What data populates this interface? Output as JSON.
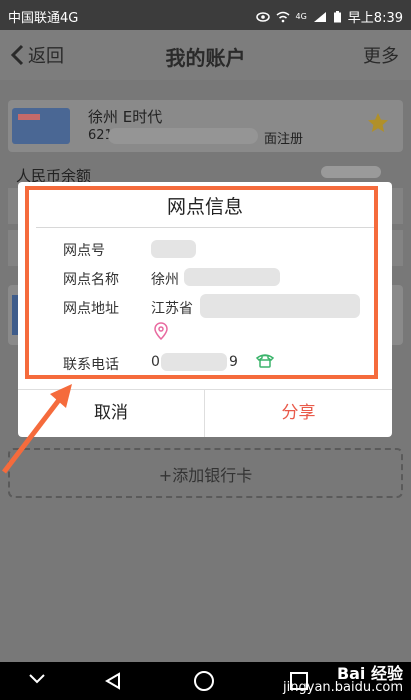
{
  "status": {
    "carrier": "中国联通4G",
    "time": "早上8:39",
    "net": "4G"
  },
  "nav": {
    "back": "返回",
    "title": "我的账户",
    "more": "更多"
  },
  "card": {
    "name": "徐州 E时代",
    "num_prefix": "621",
    "num_suffix": "面注册"
  },
  "balance_label": "人民币余额",
  "add_card": "+添加银行卡",
  "dialog": {
    "title": "网点信息",
    "rows": [
      {
        "label": "网点号",
        "value": ""
      },
      {
        "label": "网点名称",
        "value": "徐州"
      },
      {
        "label": "网点地址",
        "value": "江苏省"
      },
      {
        "label": "联系电话",
        "value": "0",
        "value_tail": "9"
      }
    ],
    "cancel": "取消",
    "share": "分享"
  },
  "watermark": {
    "brand": "Bai 经验",
    "url": "jingyan.baidu.com"
  },
  "colors": {
    "highlight": "#f56b3c",
    "share": "#e95a4a",
    "phone": "#3bb46b",
    "pin": "#e86aa0"
  }
}
